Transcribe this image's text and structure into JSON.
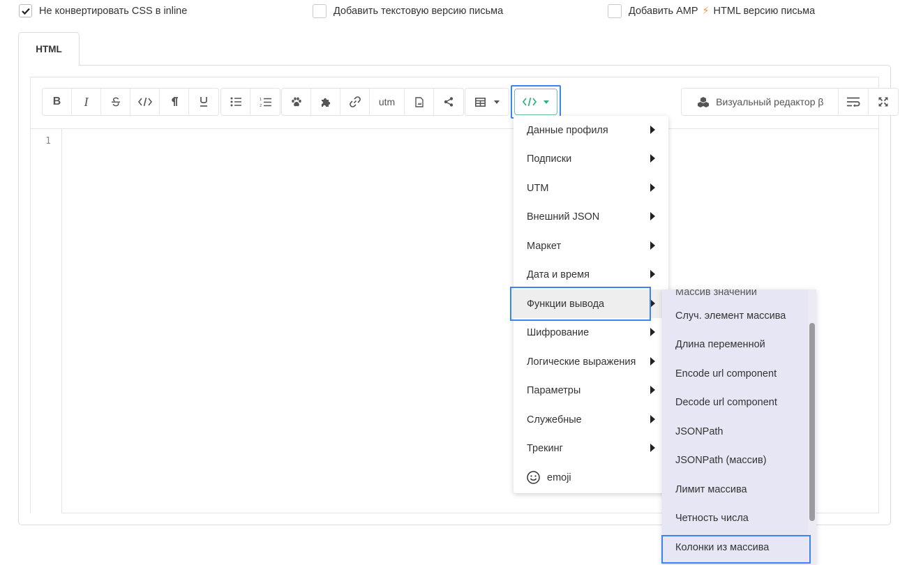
{
  "options": {
    "no_inline_css": {
      "label": "Не конвертировать CSS в inline",
      "checked": true
    },
    "text_version": {
      "label": "Добавить текстовую версию письма",
      "checked": false
    },
    "amp_version": {
      "label_before": "Добавить AMP",
      "bolt": "⚡",
      "label_after": "HTML версию письма",
      "checked": false
    }
  },
  "tabs": [
    {
      "label": "HTML",
      "active": true
    }
  ],
  "toolbar": {
    "text_buttons": [
      "B",
      "I",
      "strikethrough",
      "code",
      "paragraph",
      "underline"
    ],
    "list_buttons": [
      "bullet-list",
      "numbered-list"
    ],
    "insert_buttons": [
      "paw",
      "puzzle",
      "link",
      "utm",
      "file",
      "share"
    ],
    "utm_label": "utm",
    "table_button": "table",
    "code_button": "</>",
    "visual_editor_label": "Визуальный редактор β",
    "accent_color": "#2eaf80"
  },
  "editor": {
    "line_number": "1"
  },
  "menu": {
    "items": [
      {
        "label": "Данные профиля",
        "has_submenu": true
      },
      {
        "label": "Подписки",
        "has_submenu": true
      },
      {
        "label": "UTM",
        "has_submenu": true
      },
      {
        "label": "Внешний JSON",
        "has_submenu": true
      },
      {
        "label": "Маркет",
        "has_submenu": true
      },
      {
        "label": "Дата и время",
        "has_submenu": true
      },
      {
        "label": "Функции вывода",
        "has_submenu": true,
        "active": true
      },
      {
        "label": "Шифрование",
        "has_submenu": true
      },
      {
        "label": "Логические выражения",
        "has_submenu": true
      },
      {
        "label": "Параметры",
        "has_submenu": true
      },
      {
        "label": "Служебные",
        "has_submenu": true
      },
      {
        "label": "Трекинг",
        "has_submenu": true
      }
    ],
    "emoji_item": {
      "label": "emoji",
      "icon": "smile-icon"
    }
  },
  "submenu": {
    "partial_item": "Массив значений",
    "items": [
      "Случ. элемент массива",
      "Длина переменной",
      "Encode url component",
      "Decode url component",
      "JSONPath",
      "JSONPath (массив)",
      "Лимит массива",
      "Четность числа",
      "Колонки из массива"
    ],
    "background": "#e6e6f5"
  },
  "highlight_color": "#3b82f6"
}
